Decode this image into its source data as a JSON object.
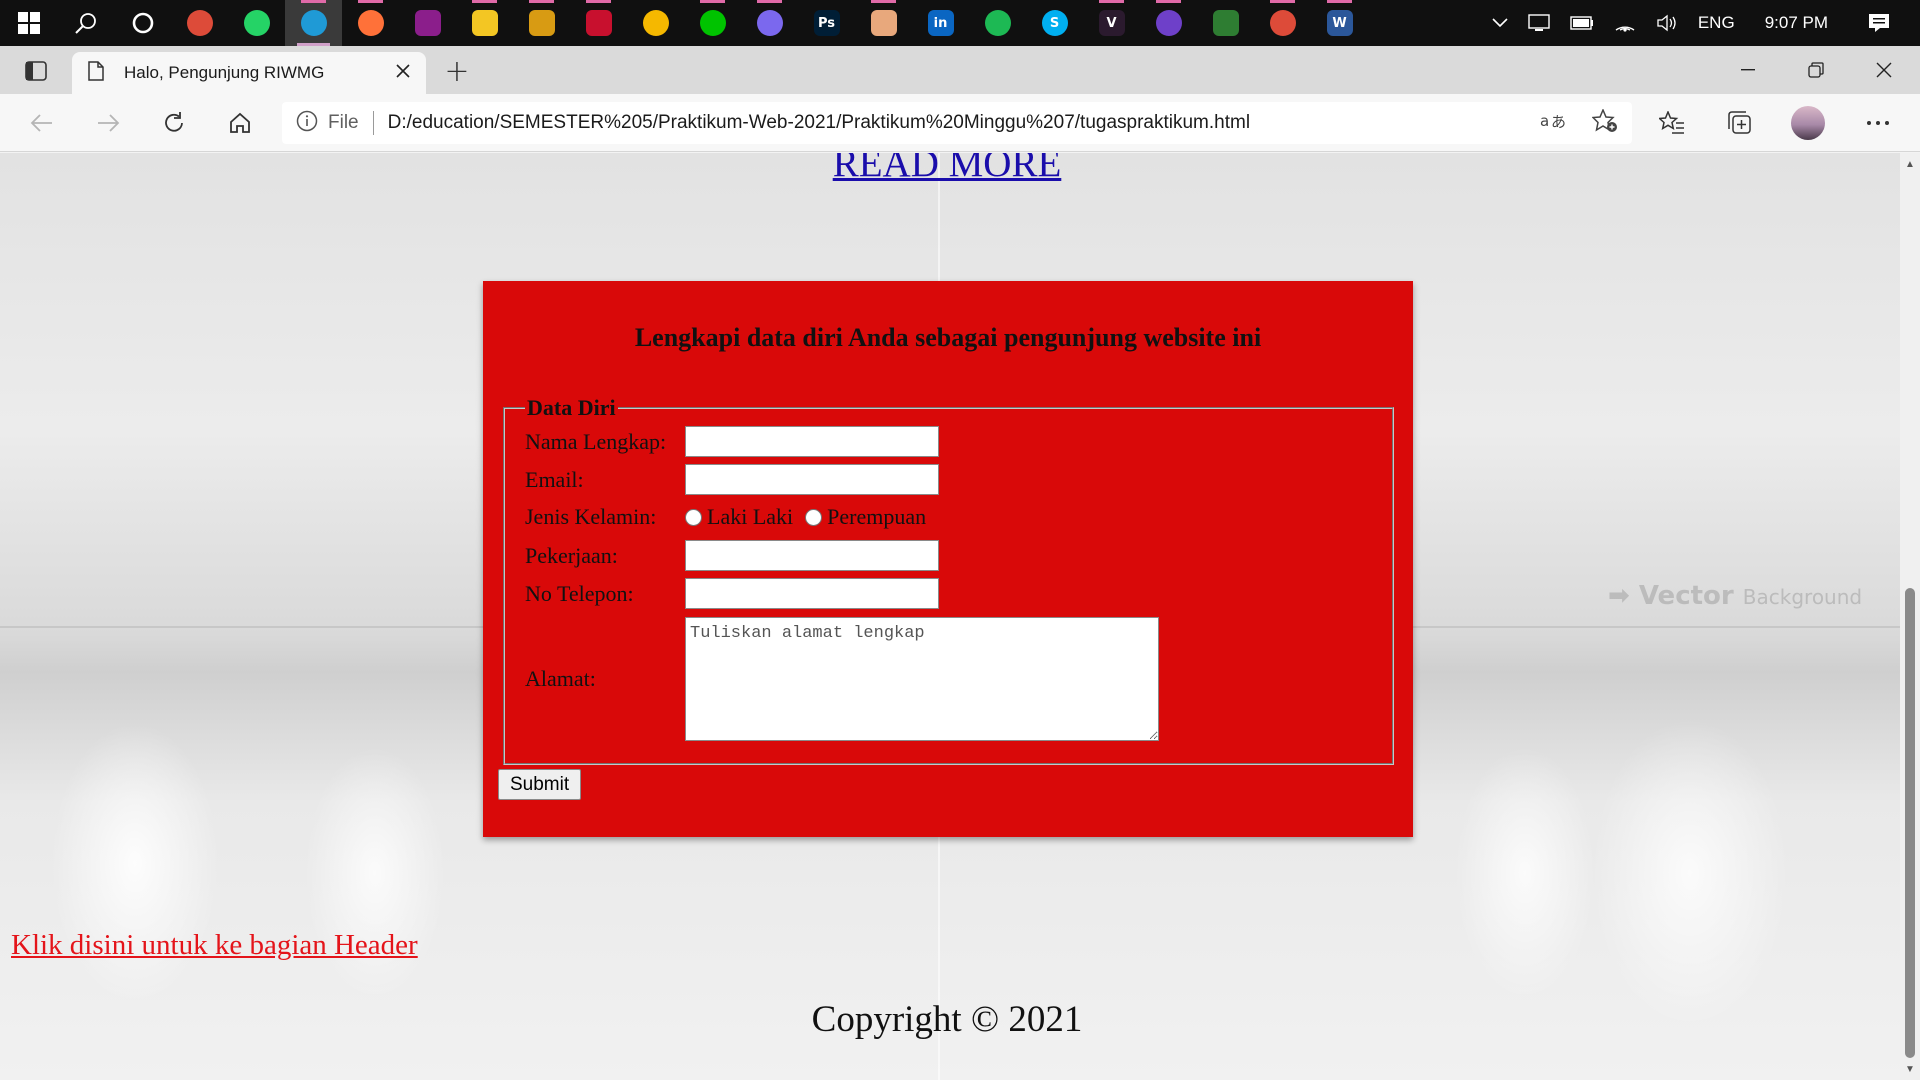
{
  "taskbar": {
    "icons": [
      {
        "name": "windows-start-icon",
        "glyph": "",
        "color": "#101010"
      },
      {
        "name": "search-icon",
        "glyph": "",
        "color": "#101010"
      },
      {
        "name": "cortana-icon",
        "glyph": "",
        "color": "#101010"
      },
      {
        "name": "chrome-icon",
        "glyph": "",
        "color": "#dd4b39"
      },
      {
        "name": "whatsapp-icon",
        "glyph": "",
        "color": "#25d366"
      },
      {
        "name": "edge-icon",
        "glyph": "",
        "color": "#1f9ad6"
      },
      {
        "name": "firefox-icon",
        "glyph": "",
        "color": "#ff7139"
      },
      {
        "name": "winrar-icon",
        "glyph": "",
        "color": "#8b1e8b"
      },
      {
        "name": "file-explorer-icon",
        "glyph": "",
        "color": "#f3c623"
      },
      {
        "name": "music-app-icon",
        "glyph": "",
        "color": "#d89b13"
      },
      {
        "name": "mendeley-icon",
        "glyph": "",
        "color": "#c8102e"
      },
      {
        "name": "triangle-app-icon",
        "glyph": "",
        "color": "#f5b800"
      },
      {
        "name": "line-icon",
        "glyph": "",
        "color": "#00c300"
      },
      {
        "name": "picasa-icon",
        "glyph": "",
        "color": "#7b68ee"
      },
      {
        "name": "photoshop-icon",
        "glyph": "Ps",
        "color": "#001e36"
      },
      {
        "name": "layers-app-icon",
        "glyph": "",
        "color": "#e8a87c"
      },
      {
        "name": "linkedin-icon",
        "glyph": "in",
        "color": "#0a66c2"
      },
      {
        "name": "spotify-icon",
        "glyph": "",
        "color": "#1db954"
      },
      {
        "name": "skype-icon",
        "glyph": "S",
        "color": "#00aff0"
      },
      {
        "name": "vector-app-icon",
        "glyph": "V",
        "color": "#2b1a2e"
      },
      {
        "name": "github-icon",
        "glyph": "",
        "color": "#6e40c9"
      },
      {
        "name": "corel-icon",
        "glyph": "",
        "color": "#2e7d32"
      },
      {
        "name": "chrome-profile-icon",
        "glyph": "",
        "color": "#dd4b39"
      },
      {
        "name": "word-icon",
        "glyph": "W",
        "color": "#2b579a"
      }
    ],
    "tray": {
      "language": "ENG",
      "time": "9:07 PM"
    }
  },
  "browser": {
    "tab_title": "Halo, Pengunjung RIWMG",
    "address": {
      "scheme_label": "File",
      "url": "D:/education/SEMESTER%205/Praktikum-Web-2021/Praktikum%20Minggu%207/tugaspraktikum.html"
    }
  },
  "page": {
    "read_more": "READ MORE",
    "form": {
      "heading": "Lengkapi data diri Anda sebagai pengunjung website ini",
      "legend": "Data Diri",
      "fields": {
        "nama": "Nama Lengkap:",
        "email": "Email:",
        "jenis_kelamin": "Jenis Kelamin:",
        "laki": "Laki Laki",
        "perempuan": "Perempuan",
        "pekerjaan": "Pekerjaan:",
        "telepon": "No Telepon:",
        "alamat": "Alamat:",
        "alamat_placeholder": "Tuliskan alamat lengkap"
      },
      "submit": "Submit",
      "background": "#d90909"
    },
    "header_link": "Klik disini untuk ke bagian Header",
    "copyright": "Copyright © 2021",
    "watermark": "Vector",
    "watermark_sub": "Background"
  }
}
